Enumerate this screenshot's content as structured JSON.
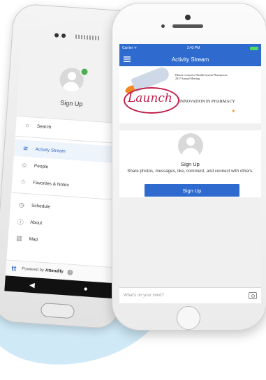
{
  "android": {
    "drawer": {
      "user_label": "Sign Up",
      "menu": [
        {
          "label": "Search",
          "icon": "search-icon",
          "glyph": "○",
          "active": false
        },
        {
          "label": "Activity Stream",
          "icon": "wifi-icon",
          "glyph": "≋",
          "active": true
        },
        {
          "label": "People",
          "icon": "people-icon",
          "glyph": "☺",
          "active": false
        },
        {
          "label": "Favorites & Notes",
          "icon": "star-icon",
          "glyph": "☆",
          "active": false
        },
        {
          "label": "Schedule",
          "icon": "clock-icon",
          "glyph": "◷",
          "active": false
        },
        {
          "label": "About",
          "icon": "info-icon",
          "glyph": "ⓘ",
          "active": false
        },
        {
          "label": "Map",
          "icon": "map-icon",
          "glyph": "▥",
          "active": false
        }
      ],
      "powered_prefix": "Powered by",
      "powered_brand": "Attendify",
      "logo_text": "tt"
    },
    "navbar": {
      "back": "◀",
      "home": "●"
    }
  },
  "iphone": {
    "status": {
      "carrier": "Carrier ᯤ",
      "time": "3:43 PM"
    },
    "title": "Activity Stream",
    "banner": {
      "org_line1": "Illinois Council of Health-System Pharmacists",
      "org_line2": "2017 Annual Meeting",
      "launch": "Launch",
      "tagline": "INNOVATION IN PHARMACY"
    },
    "signup_card": {
      "title": "Sign Up",
      "description": "Share photos, messages, like, comment, and connect with others.",
      "button": "Sign Up"
    },
    "composer_placeholder": "What's on your mind?"
  },
  "colors": {
    "accent": "#2f6bcf",
    "launch": "#c21f4b",
    "online": "#4caf50"
  }
}
